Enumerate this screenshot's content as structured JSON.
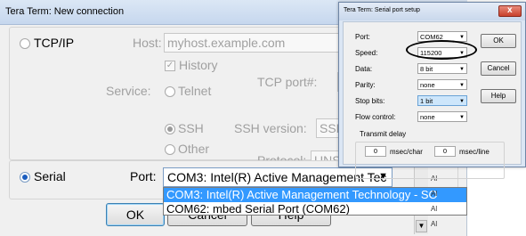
{
  "main": {
    "title": "Tera Term: New connection",
    "tcp": {
      "label": "TCP/IP",
      "host_label": "Host:",
      "host_value": "myhost.example.com",
      "history_label": "History",
      "service_label": "Service:",
      "telnet_label": "Telnet",
      "ssh_label": "SSH",
      "other_label": "Other",
      "tcp_port_label": "TCP port#:",
      "tcp_port_value": "2",
      "ssh_version_label": "SSH version:",
      "ssh_version_value": "SSH",
      "protocol_label": "Protocol:",
      "protocol_value": "UNS"
    },
    "serial": {
      "label": "Serial",
      "port_label": "Port:",
      "port_value": "COM3: Intel(R) Active Management Tec",
      "options": [
        "COM3: Intel(R) Active Management Technology - SO",
        "COM62: mbed Serial Port (COM62)"
      ]
    },
    "buttons": {
      "ok": "OK",
      "cancel": "Cancel",
      "help": "Help"
    },
    "side_frags": [
      "Al",
      "Al",
      "Al",
      "Al",
      "Al",
      "Al"
    ]
  },
  "serial_setup": {
    "title": "Tera Term: Serial port setup",
    "port_label": "Port:",
    "port_value": "COM62",
    "speed_label": "Speed:",
    "speed_value": "115200",
    "data_label": "Data:",
    "data_value": "8 bit",
    "parity_label": "Parity:",
    "parity_value": "none",
    "stop_label": "Stop bits:",
    "stop_value": "1 bit",
    "flow_label": "Flow control:",
    "flow_value": "none",
    "ok_label": "OK",
    "cancel_label": "Cancel",
    "help_label": "Help",
    "transmit_delay_label": "Transmit delay",
    "char_delay_value": "0",
    "char_unit": "msec/char",
    "line_delay_value": "0",
    "line_unit": "msec/line"
  },
  "icons": {
    "dropdown": "chevron-down-icon",
    "close": "close-icon",
    "check": "checkmark-icon"
  },
  "colors": {
    "selection": "#3399ff",
    "title_bar": "#c6d7ee",
    "close_button": "#c7402c"
  }
}
